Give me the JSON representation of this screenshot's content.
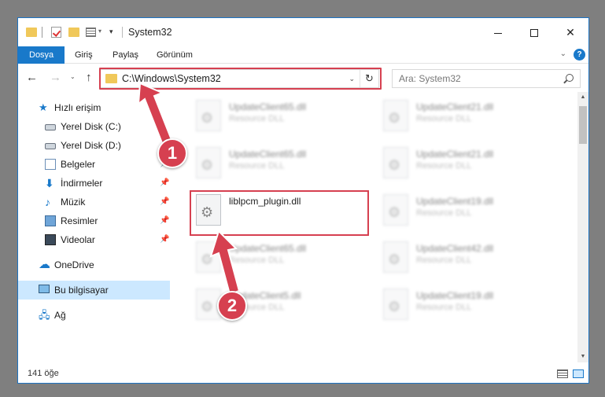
{
  "window": {
    "title": "System32"
  },
  "ribbon": {
    "tabs": [
      "Dosya",
      "Giriş",
      "Paylaş",
      "Görünüm"
    ],
    "help": "?"
  },
  "address": {
    "path": "C:\\Windows\\System32",
    "search_placeholder": "Ara: System32"
  },
  "nav": {
    "quick_access": "Hızlı erişim",
    "items": [
      {
        "label": "Yerel Disk (C:)",
        "pinned": false
      },
      {
        "label": "Yerel Disk (D:)",
        "pinned": false
      },
      {
        "label": "Belgeler",
        "pinned": true
      },
      {
        "label": "İndirmeler",
        "pinned": true
      },
      {
        "label": "Müzik",
        "pinned": true
      },
      {
        "label": "Resimler",
        "pinned": true
      },
      {
        "label": "Videolar",
        "pinned": true
      }
    ],
    "onedrive": "OneDrive",
    "this_pc": "Bu bilgisayar",
    "network": "Ağ"
  },
  "files": {
    "highlighted": {
      "name": "liblpcm_plugin.dll",
      "desc": ""
    },
    "left_column": [
      {
        "name": "UpdateClient65.dll",
        "desc": "Resource DLL"
      },
      {
        "name": "UpdateClient65.dll",
        "desc": "Resource DLL"
      },
      {
        "name": "UpdateClient65.dll",
        "desc": "Resource DLL"
      },
      {
        "name": "UpdateClient5.dll",
        "desc": "Resource DLL"
      }
    ],
    "right_column": [
      {
        "name": "UpdateClient21.dll",
        "desc": "Resource DLL"
      },
      {
        "name": "UpdateClient21.dll",
        "desc": "Resource DLL"
      },
      {
        "name": "UpdateClient19.dll",
        "desc": "Resource DLL"
      },
      {
        "name": "UpdateClient42.dll",
        "desc": "Resource DLL"
      },
      {
        "name": "UpdateClient19.dll",
        "desc": "Resource DLL"
      }
    ]
  },
  "status": {
    "count": "141 öğe"
  },
  "annotations": {
    "step1": "1",
    "step2": "2"
  },
  "colors": {
    "accent": "#1979ca",
    "highlight": "#d64050",
    "selected_bg": "#cce8ff"
  }
}
